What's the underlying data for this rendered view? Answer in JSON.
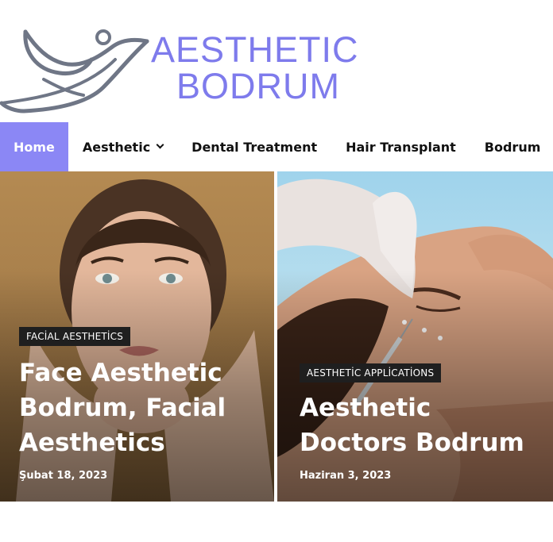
{
  "logo": {
    "line1": "AESTHETIC",
    "line2": "BODRUM",
    "color": "#7e7bec"
  },
  "nav": {
    "items": [
      {
        "label": "Home",
        "active": true
      },
      {
        "label": "Aesthetic",
        "has_dropdown": true
      },
      {
        "label": "Dental Treatment"
      },
      {
        "label": "Hair Transplant"
      },
      {
        "label": "Bodrum"
      }
    ],
    "active_color": "#8b87f5"
  },
  "posts": [
    {
      "category": "FACİAL AESTHETİCS",
      "title": "Face Aesthetic Bodrum, Facial Aesthetics",
      "date": "Şubat 18, 2023",
      "image": "woman-face-hands-photo"
    },
    {
      "category": "AESTHETİC APPLİCATİONS",
      "title": "Aesthetic Doctors Bodrum",
      "date": "Haziran 3, 2023",
      "image": "facial-injection-photo"
    }
  ]
}
